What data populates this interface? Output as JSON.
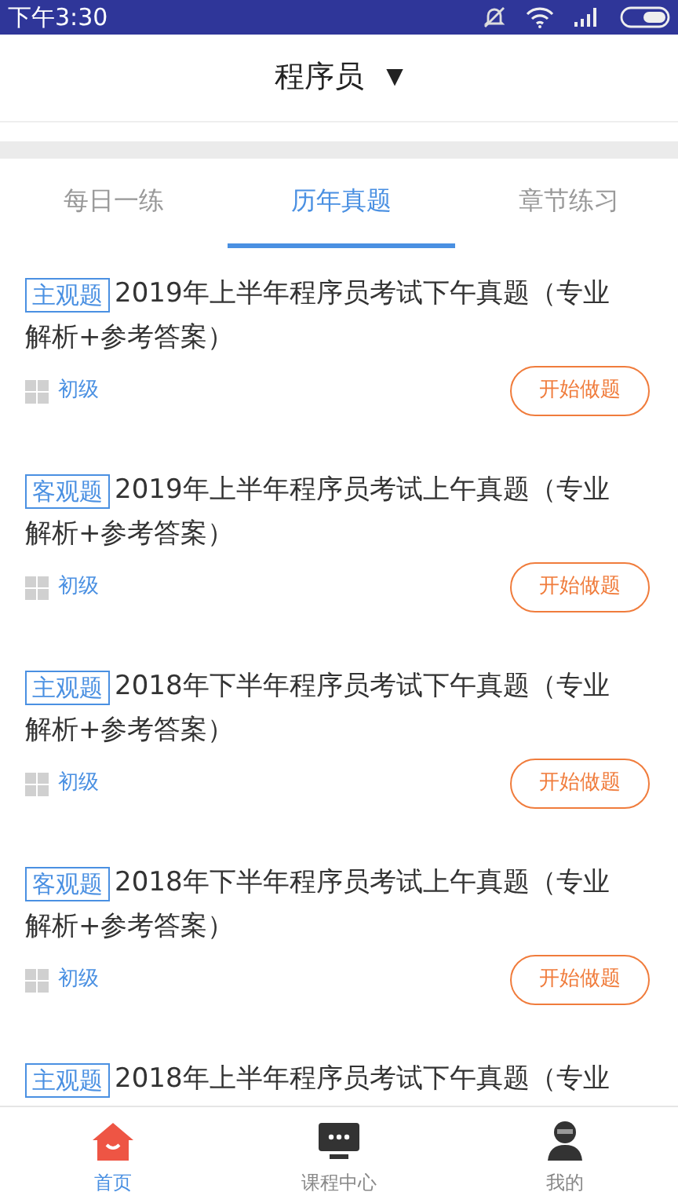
{
  "status_bar": {
    "time": "下午3:30"
  },
  "header": {
    "title": "程序员",
    "dropdown_glyph": "▼"
  },
  "tabs": [
    {
      "label": "每日一练",
      "selected": false
    },
    {
      "label": "历年真题",
      "selected": true
    },
    {
      "label": "章节练习",
      "selected": false
    }
  ],
  "papers": [
    {
      "tag": "主观题",
      "title_lines": [
        "2019年上半年程序员考试下午真题（专业",
        "解析+参考答案）"
      ],
      "level": "初级",
      "button": "开始做题"
    },
    {
      "tag": "客观题",
      "title_lines": [
        "2019年上半年程序员考试上午真题（专业",
        "解析+参考答案）"
      ],
      "level": "初级",
      "button": "开始做题"
    },
    {
      "tag": "主观题",
      "title_lines": [
        "2018年下半年程序员考试下午真题（专业",
        "解析+参考答案）"
      ],
      "level": "初级",
      "button": "开始做题"
    },
    {
      "tag": "客观题",
      "title_lines": [
        "2018年下半年程序员考试上午真题（专业",
        "解析+参考答案）"
      ],
      "level": "初级",
      "button": "开始做题"
    },
    {
      "tag": "主观题",
      "title_lines": [
        "2018年上半年程序员考试下午真题（专业"
      ]
    }
  ],
  "bottom_nav": [
    {
      "label": "首页",
      "kind": "home",
      "selected": true
    },
    {
      "label": "课程中心",
      "kind": "courses",
      "selected": false
    },
    {
      "label": "我的",
      "kind": "profile",
      "selected": false
    }
  ]
}
